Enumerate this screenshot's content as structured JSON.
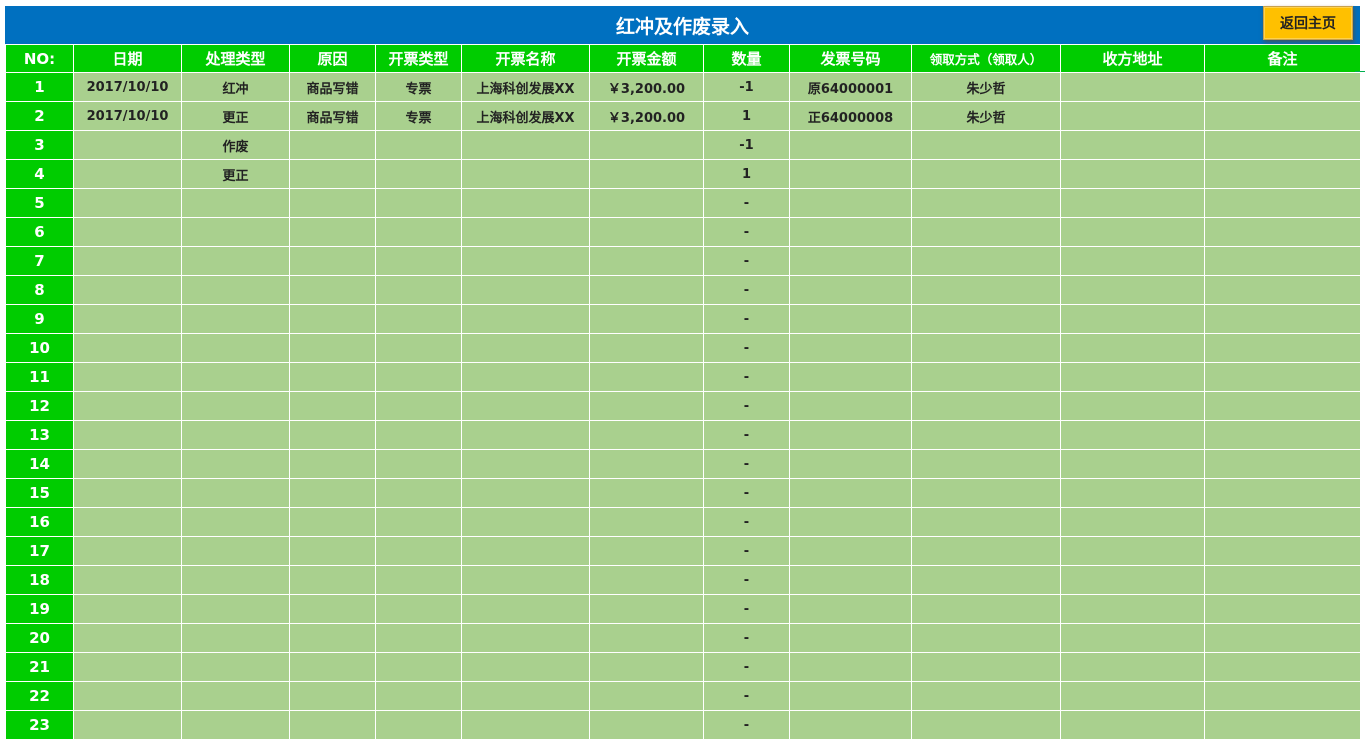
{
  "title": "红冲及作废录入",
  "home_button": "返回主页",
  "columns": [
    "NO:",
    "日期",
    "处理类型",
    "原因",
    "开票类型",
    "开票名称",
    "开票金额",
    "数量",
    "发票号码",
    "领取方式（领取人）",
    "收方地址",
    "备注"
  ],
  "rows": [
    {
      "no": "1",
      "date": "2017/10/10",
      "type": "红冲",
      "reason": "商品写错",
      "invoice_type": "专票",
      "invoice_name": "上海科创发展XX",
      "amount": "￥3,200.00",
      "qty": "-1",
      "invoice_no": "原64000001",
      "receiver": "朱少哲",
      "address": "",
      "note": ""
    },
    {
      "no": "2",
      "date": "2017/10/10",
      "type": "更正",
      "reason": "商品写错",
      "invoice_type": "专票",
      "invoice_name": "上海科创发展XX",
      "amount": "￥3,200.00",
      "qty": "1",
      "invoice_no": "正64000008",
      "receiver": "朱少哲",
      "address": "",
      "note": ""
    },
    {
      "no": "3",
      "date": "",
      "type": "作废",
      "reason": "",
      "invoice_type": "",
      "invoice_name": "",
      "amount": "",
      "qty": "-1",
      "invoice_no": "",
      "receiver": "",
      "address": "",
      "note": ""
    },
    {
      "no": "4",
      "date": "",
      "type": "更正",
      "reason": "",
      "invoice_type": "",
      "invoice_name": "",
      "amount": "",
      "qty": "1",
      "invoice_no": "",
      "receiver": "",
      "address": "",
      "note": ""
    },
    {
      "no": "5",
      "date": "",
      "type": "",
      "reason": "",
      "invoice_type": "",
      "invoice_name": "",
      "amount": "",
      "qty": "-",
      "invoice_no": "",
      "receiver": "",
      "address": "",
      "note": ""
    },
    {
      "no": "6",
      "date": "",
      "type": "",
      "reason": "",
      "invoice_type": "",
      "invoice_name": "",
      "amount": "",
      "qty": "-",
      "invoice_no": "",
      "receiver": "",
      "address": "",
      "note": ""
    },
    {
      "no": "7",
      "date": "",
      "type": "",
      "reason": "",
      "invoice_type": "",
      "invoice_name": "",
      "amount": "",
      "qty": "-",
      "invoice_no": "",
      "receiver": "",
      "address": "",
      "note": ""
    },
    {
      "no": "8",
      "date": "",
      "type": "",
      "reason": "",
      "invoice_type": "",
      "invoice_name": "",
      "amount": "",
      "qty": "-",
      "invoice_no": "",
      "receiver": "",
      "address": "",
      "note": ""
    },
    {
      "no": "9",
      "date": "",
      "type": "",
      "reason": "",
      "invoice_type": "",
      "invoice_name": "",
      "amount": "",
      "qty": "-",
      "invoice_no": "",
      "receiver": "",
      "address": "",
      "note": ""
    },
    {
      "no": "10",
      "date": "",
      "type": "",
      "reason": "",
      "invoice_type": "",
      "invoice_name": "",
      "amount": "",
      "qty": "-",
      "invoice_no": "",
      "receiver": "",
      "address": "",
      "note": ""
    },
    {
      "no": "11",
      "date": "",
      "type": "",
      "reason": "",
      "invoice_type": "",
      "invoice_name": "",
      "amount": "",
      "qty": "-",
      "invoice_no": "",
      "receiver": "",
      "address": "",
      "note": ""
    },
    {
      "no": "12",
      "date": "",
      "type": "",
      "reason": "",
      "invoice_type": "",
      "invoice_name": "",
      "amount": "",
      "qty": "-",
      "invoice_no": "",
      "receiver": "",
      "address": "",
      "note": ""
    },
    {
      "no": "13",
      "date": "",
      "type": "",
      "reason": "",
      "invoice_type": "",
      "invoice_name": "",
      "amount": "",
      "qty": "-",
      "invoice_no": "",
      "receiver": "",
      "address": "",
      "note": ""
    },
    {
      "no": "14",
      "date": "",
      "type": "",
      "reason": "",
      "invoice_type": "",
      "invoice_name": "",
      "amount": "",
      "qty": "-",
      "invoice_no": "",
      "receiver": "",
      "address": "",
      "note": ""
    },
    {
      "no": "15",
      "date": "",
      "type": "",
      "reason": "",
      "invoice_type": "",
      "invoice_name": "",
      "amount": "",
      "qty": "-",
      "invoice_no": "",
      "receiver": "",
      "address": "",
      "note": ""
    },
    {
      "no": "16",
      "date": "",
      "type": "",
      "reason": "",
      "invoice_type": "",
      "invoice_name": "",
      "amount": "",
      "qty": "-",
      "invoice_no": "",
      "receiver": "",
      "address": "",
      "note": ""
    },
    {
      "no": "17",
      "date": "",
      "type": "",
      "reason": "",
      "invoice_type": "",
      "invoice_name": "",
      "amount": "",
      "qty": "-",
      "invoice_no": "",
      "receiver": "",
      "address": "",
      "note": ""
    },
    {
      "no": "18",
      "date": "",
      "type": "",
      "reason": "",
      "invoice_type": "",
      "invoice_name": "",
      "amount": "",
      "qty": "-",
      "invoice_no": "",
      "receiver": "",
      "address": "",
      "note": ""
    },
    {
      "no": "19",
      "date": "",
      "type": "",
      "reason": "",
      "invoice_type": "",
      "invoice_name": "",
      "amount": "",
      "qty": "-",
      "invoice_no": "",
      "receiver": "",
      "address": "",
      "note": ""
    },
    {
      "no": "20",
      "date": "",
      "type": "",
      "reason": "",
      "invoice_type": "",
      "invoice_name": "",
      "amount": "",
      "qty": "-",
      "invoice_no": "",
      "receiver": "",
      "address": "",
      "note": ""
    },
    {
      "no": "21",
      "date": "",
      "type": "",
      "reason": "",
      "invoice_type": "",
      "invoice_name": "",
      "amount": "",
      "qty": "-",
      "invoice_no": "",
      "receiver": "",
      "address": "",
      "note": ""
    },
    {
      "no": "22",
      "date": "",
      "type": "",
      "reason": "",
      "invoice_type": "",
      "invoice_name": "",
      "amount": "",
      "qty": "-",
      "invoice_no": "",
      "receiver": "",
      "address": "",
      "note": ""
    },
    {
      "no": "23",
      "date": "",
      "type": "",
      "reason": "",
      "invoice_type": "",
      "invoice_name": "",
      "amount": "",
      "qty": "-",
      "invoice_no": "",
      "receiver": "",
      "address": "",
      "note": ""
    }
  ],
  "colors": {
    "title_bg": "#0070c0",
    "header_bg": "#00cc00",
    "cell_bg": "#a9d08e",
    "button_bg": "#ffc000"
  }
}
